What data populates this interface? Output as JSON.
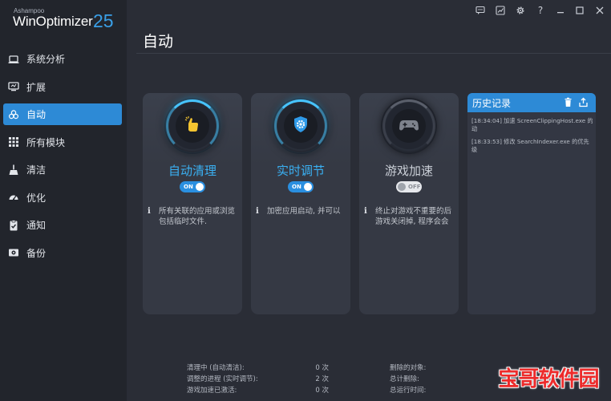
{
  "brand": {
    "maker": "Ashampoo",
    "product": "WinOptimizer",
    "version": "25"
  },
  "sidebar": {
    "items": [
      {
        "label": "系统分析",
        "icon": "laptop-icon",
        "active": false
      },
      {
        "label": "扩展",
        "icon": "monitor-icon",
        "active": false
      },
      {
        "label": "自动",
        "icon": "biohazard-icon",
        "active": true
      },
      {
        "label": "所有模块",
        "icon": "grid-icon",
        "active": false
      },
      {
        "label": "清洁",
        "icon": "broom-icon",
        "active": false
      },
      {
        "label": "优化",
        "icon": "gauge-icon",
        "active": false
      },
      {
        "label": "通知",
        "icon": "clipboard-check-icon",
        "active": false
      },
      {
        "label": "备份",
        "icon": "backup-icon",
        "active": false
      }
    ]
  },
  "titlebar": {
    "icons": [
      "feedback-icon",
      "chart-icon",
      "gear-icon",
      "help-icon",
      "minimize-icon",
      "maximize-icon",
      "close-icon"
    ],
    "help_label": "?"
  },
  "page": {
    "title": "自动"
  },
  "cards": [
    {
      "title": "自动清理",
      "toggle": "ON",
      "state": "on",
      "icon": "cleaning-hand-icon",
      "desc": "所有关联的应用或浏览\n包括临时文件."
    },
    {
      "title": "实时调节",
      "toggle": "ON",
      "state": "on",
      "icon": "shield-gear-icon",
      "desc": "加密应用启动, 并可以"
    },
    {
      "title": "游戏加速",
      "toggle": "OFF",
      "state": "off",
      "icon": "gamepad-icon",
      "desc": "终止对游戏不重要的后\n游戏关闭掉, 程序会会"
    }
  ],
  "info_symbol": "i",
  "history": {
    "title": "历史记录",
    "entries": [
      "[18:34:04] 加速 ScreenClippingHost.exe 的启\n动",
      "[18:33:53] 修改 SearchIndexer.exe 的优先\n级"
    ]
  },
  "stats": {
    "left": [
      {
        "label": "清理中 (自动清洁):",
        "value": "0 次"
      },
      {
        "label": "调整的进程 (实时调节):",
        "value": "2 次"
      },
      {
        "label": "游戏加速已激活:",
        "value": "0 次"
      }
    ],
    "right": [
      {
        "label": "删除的对象:"
      },
      {
        "label": "总计删除:"
      },
      {
        "label": "总运行时间:"
      }
    ]
  },
  "colors": {
    "accent": "#2d8ad6",
    "title_blue": "#3ab0f2",
    "background": "#2a2d36",
    "sidebar": "#22252c"
  },
  "watermark": {
    "text": "宝哥软件园"
  }
}
